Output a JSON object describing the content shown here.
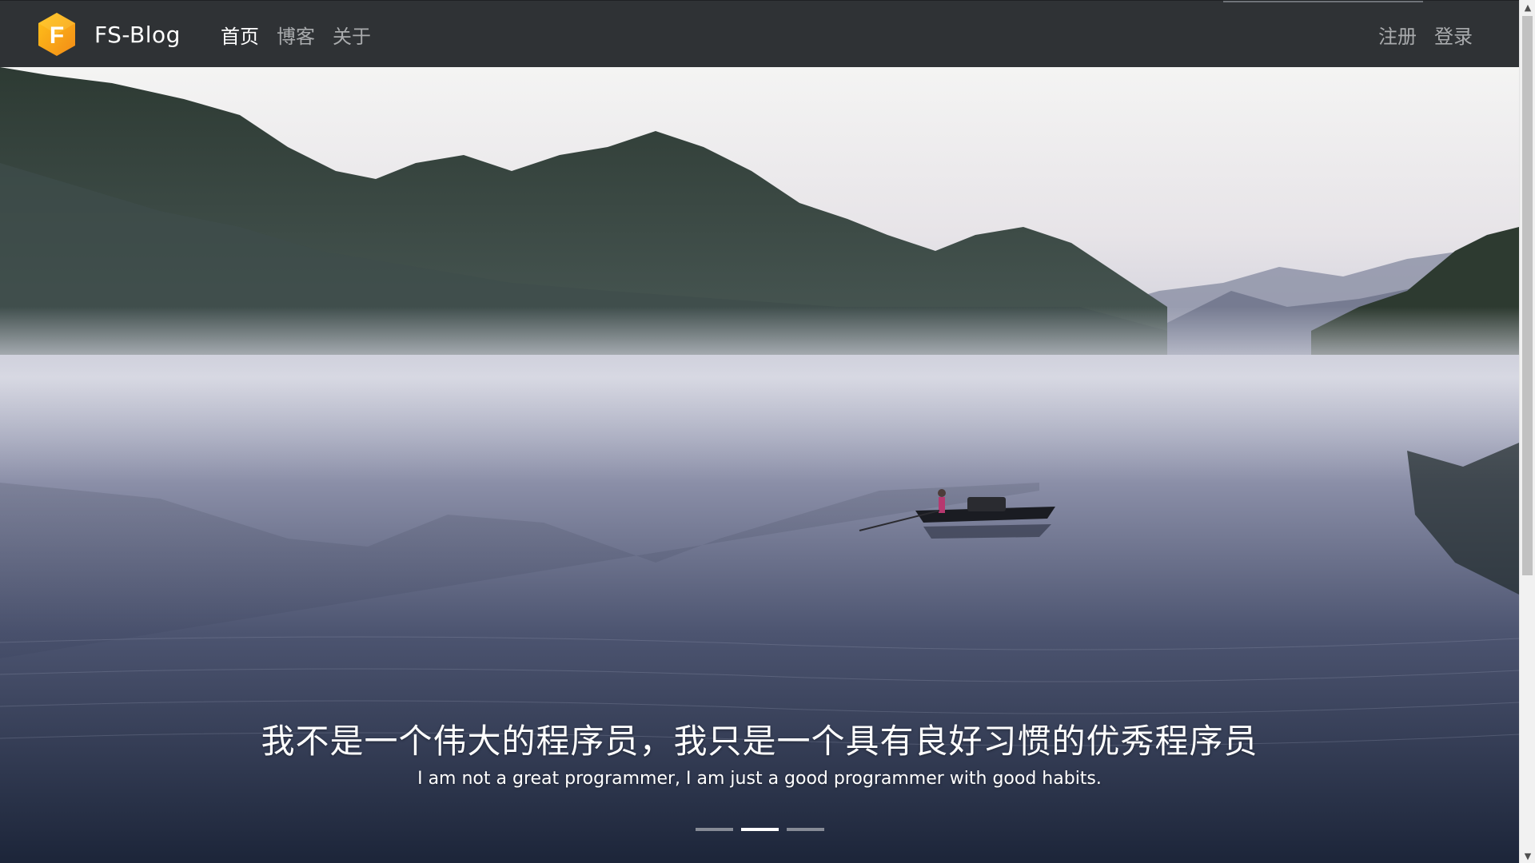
{
  "brand": {
    "name": "FS-Blog",
    "logo_letter": "F",
    "logo_color_top": "#ffc21a",
    "logo_color_bottom": "#f38b16"
  },
  "nav": {
    "items": [
      {
        "label": "首页",
        "active": true
      },
      {
        "label": "博客",
        "active": false
      },
      {
        "label": "关于",
        "active": false
      }
    ],
    "right": [
      {
        "label": "注册"
      },
      {
        "label": "登录"
      }
    ]
  },
  "hero": {
    "title": "我不是一个伟大的程序员，我只是一个具有良好习惯的优秀程序员",
    "subtitle": "I am not a great programmer, I am just a good programmer with good habits.",
    "slides_total": 3,
    "active_slide": 2
  },
  "colors": {
    "navbar": "#2f3235",
    "nav_text": "#a9abad",
    "nav_active": "#ffffff"
  },
  "icons": {
    "scroll_up": "▲",
    "scroll_down": "▼"
  }
}
